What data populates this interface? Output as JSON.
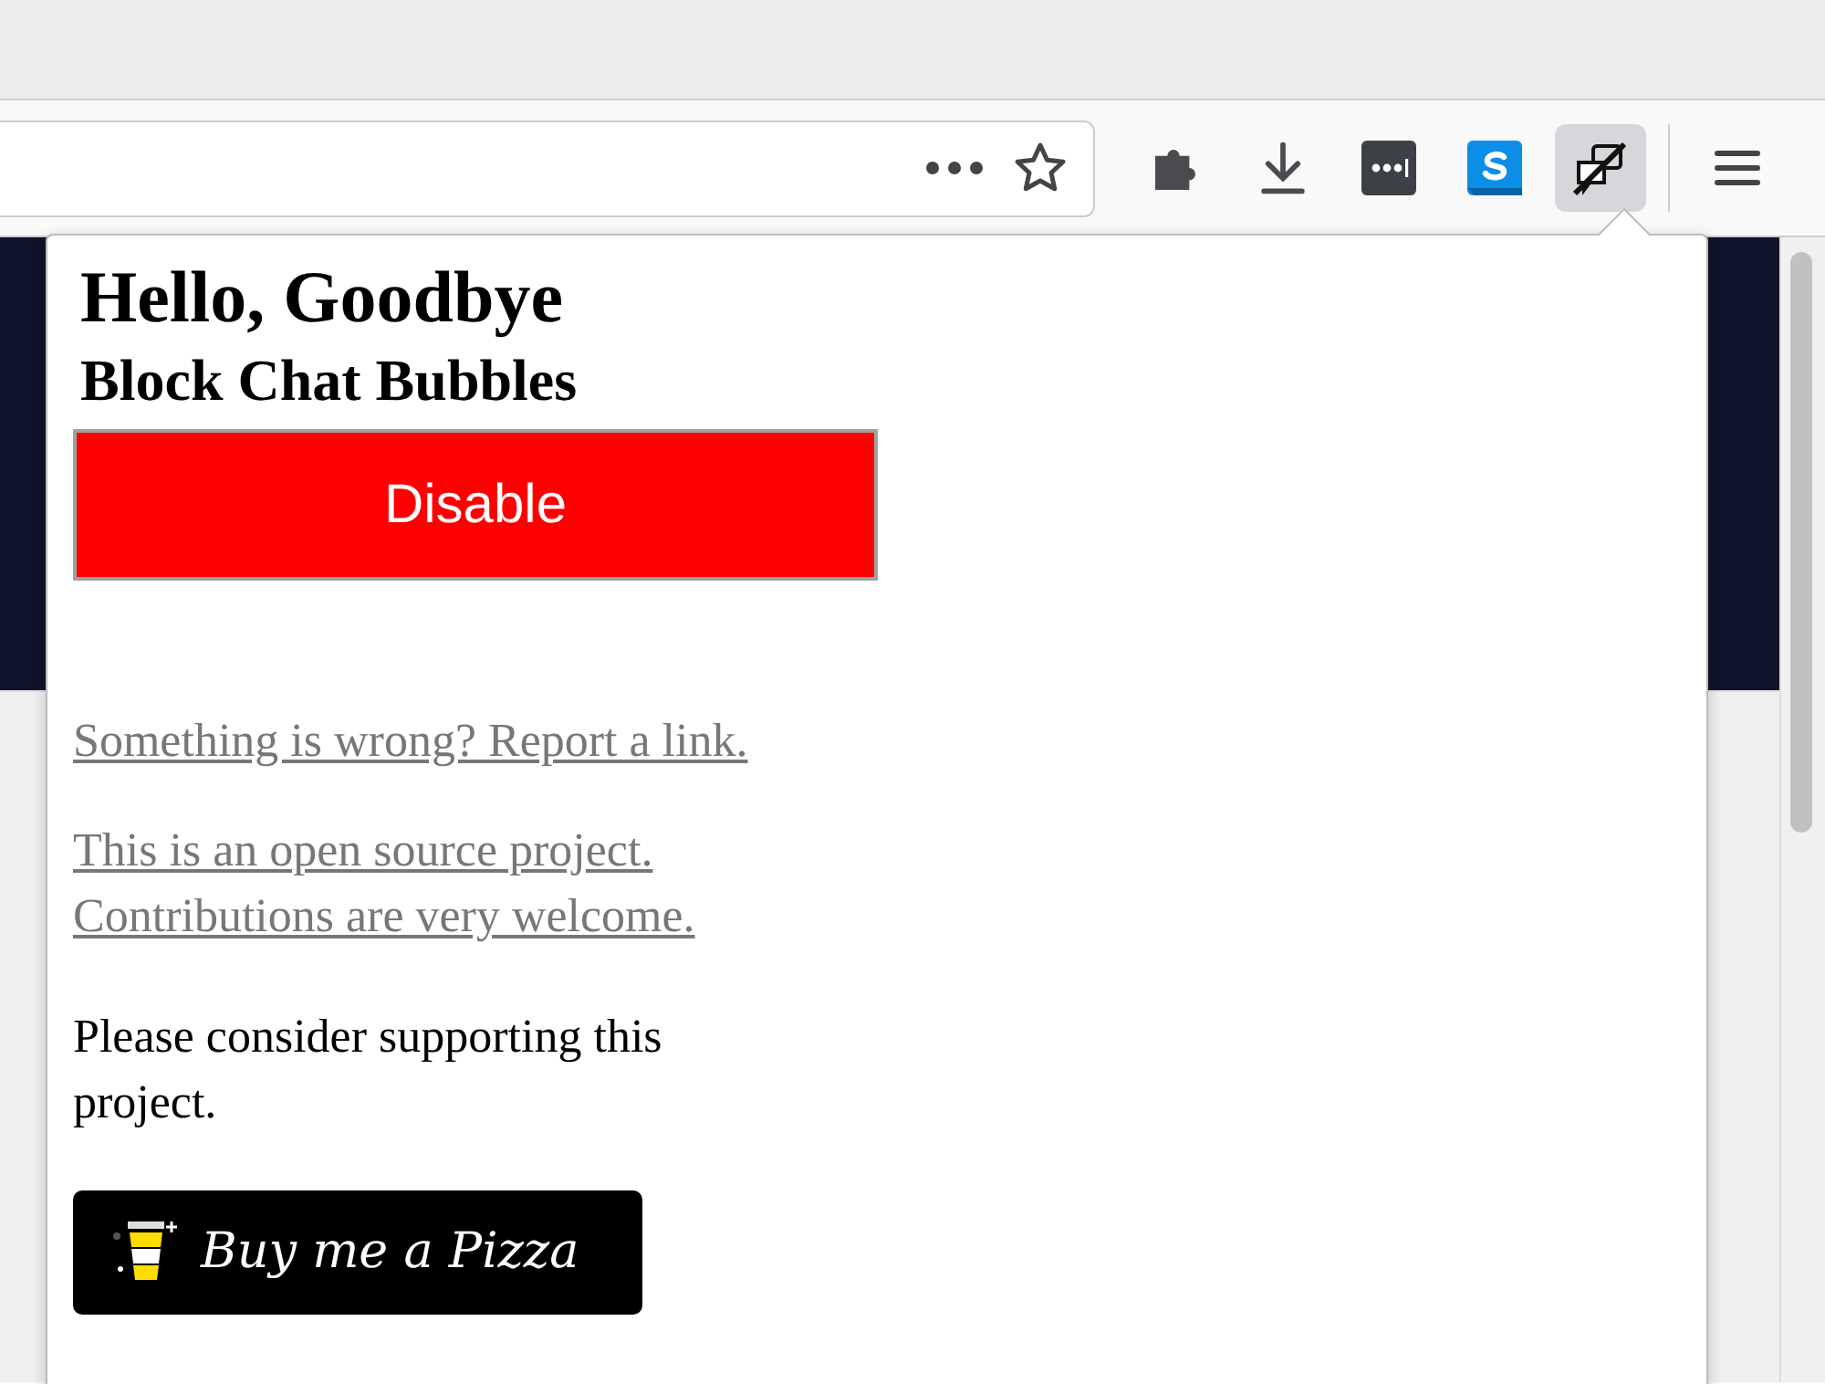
{
  "toolbar": {
    "buttons": [
      {
        "kind": "extensions",
        "selected": false
      },
      {
        "kind": "downloads",
        "selected": false
      },
      {
        "kind": "password",
        "selected": false
      },
      {
        "kind": "skype",
        "selected": false
      },
      {
        "kind": "chat-block",
        "selected": true
      }
    ]
  },
  "popup": {
    "title": "Hello, Goodbye",
    "subtitle": "Block Chat Bubbles",
    "toggle_button": {
      "label": "Disable",
      "enabled": true
    },
    "links": [
      "Something is wrong? Report a link.",
      "This is an open source project. Contributions are very welcome."
    ],
    "support_text": "Please consider supporting this project.",
    "donate_button": {
      "label": "Buy me a Pizza"
    }
  }
}
